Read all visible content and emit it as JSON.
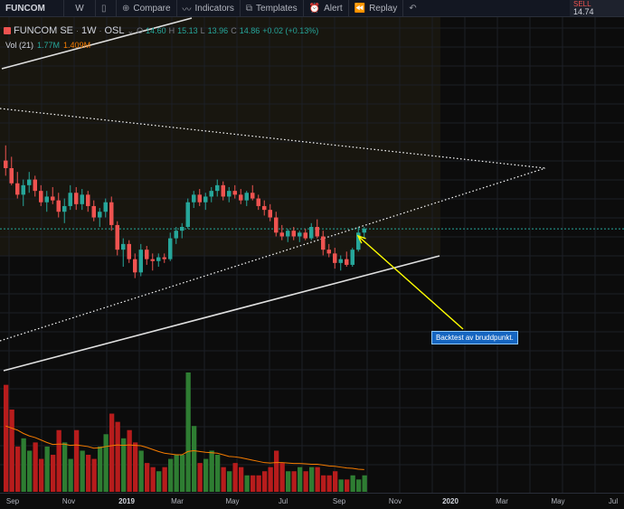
{
  "toolbar": {
    "symbol": "FUNCOM",
    "interval": "W",
    "compare": "Compare",
    "indicators": "Indicators",
    "templates": "Templates",
    "alert": "Alert",
    "replay": "Replay"
  },
  "quote": {
    "sell_label": "SELL",
    "sell_value": "14.74"
  },
  "legend": {
    "name": "FUNCOM SE",
    "interval": "1W",
    "exchange": "OSL",
    "open_label": "O",
    "open": "14.60",
    "high_label": "H",
    "high": "15.13",
    "low_label": "L",
    "low": "13.96",
    "close_label": "C",
    "close": "14.86",
    "change": "+0.02 (+0.13%)"
  },
  "volume_legend": {
    "label": "Vol (21)",
    "value1": "1.77M",
    "value2": "1.409M"
  },
  "annotation": {
    "text": "Backtest av bruddpunkt."
  },
  "xaxis": {
    "labels": [
      {
        "text": "Sep",
        "bold": false
      },
      {
        "text": "Nov",
        "bold": false
      },
      {
        "text": "2019",
        "bold": true
      },
      {
        "text": "Mar",
        "bold": false
      },
      {
        "text": "May",
        "bold": false
      },
      {
        "text": "Jul",
        "bold": false
      },
      {
        "text": "Sep",
        "bold": false
      },
      {
        "text": "Nov",
        "bold": false
      },
      {
        "text": "2020",
        "bold": true
      },
      {
        "text": "Mar",
        "bold": false
      },
      {
        "text": "May",
        "bold": false
      },
      {
        "text": "Jul",
        "bold": false
      }
    ]
  },
  "colors": {
    "up": "#26a69a",
    "down": "#ef5350",
    "vol_up": "#2e7d32",
    "vol_down": "#b71c1c",
    "ma": "#f57c00",
    "trendline": "#e0e0e0",
    "price_line": "#26a69a",
    "arrow": "#ffff00"
  },
  "chart_data": {
    "type": "candlestick",
    "candles": [
      [
        16.2,
        17.0,
        15.4,
        15.8
      ],
      [
        15.8,
        16.4,
        14.9,
        15.0
      ],
      [
        15.0,
        15.6,
        14.2,
        14.4
      ],
      [
        14.4,
        15.2,
        13.8,
        14.9
      ],
      [
        14.9,
        15.6,
        14.5,
        15.2
      ],
      [
        15.2,
        15.4,
        14.3,
        14.6
      ],
      [
        14.6,
        14.9,
        13.8,
        14.0
      ],
      [
        14.0,
        14.6,
        13.5,
        14.3
      ],
      [
        14.3,
        14.8,
        13.9,
        14.1
      ],
      [
        14.1,
        14.5,
        13.2,
        13.5
      ],
      [
        13.5,
        14.2,
        12.9,
        13.8
      ],
      [
        13.8,
        14.9,
        13.6,
        14.5
      ],
      [
        14.5,
        14.8,
        13.6,
        13.9
      ],
      [
        13.9,
        14.7,
        13.6,
        14.4
      ],
      [
        14.4,
        14.6,
        13.5,
        13.8
      ],
      [
        13.8,
        14.1,
        13.0,
        13.2
      ],
      [
        13.2,
        13.7,
        12.7,
        13.5
      ],
      [
        13.5,
        14.2,
        13.2,
        14.0
      ],
      [
        14.0,
        14.3,
        12.5,
        12.8
      ],
      [
        12.8,
        13.0,
        11.2,
        11.5
      ],
      [
        11.5,
        12.1,
        10.6,
        11.8
      ],
      [
        11.8,
        12.0,
        10.8,
        11.0
      ],
      [
        11.0,
        11.3,
        10.0,
        10.3
      ],
      [
        10.3,
        11.8,
        10.1,
        11.5
      ],
      [
        11.5,
        11.7,
        10.7,
        11.0
      ],
      [
        11.0,
        11.3,
        10.4,
        10.9
      ],
      [
        10.9,
        11.3,
        10.6,
        11.1
      ],
      [
        11.1,
        11.3,
        10.8,
        11.0
      ],
      [
        11.0,
        12.4,
        10.9,
        12.1
      ],
      [
        12.1,
        12.7,
        11.8,
        12.5
      ],
      [
        12.5,
        12.9,
        12.1,
        12.7
      ],
      [
        12.7,
        14.2,
        12.6,
        14.0
      ],
      [
        14.0,
        14.6,
        13.7,
        14.4
      ],
      [
        14.4,
        14.7,
        13.8,
        14.0
      ],
      [
        14.0,
        14.5,
        13.6,
        14.3
      ],
      [
        14.3,
        14.8,
        14.0,
        14.6
      ],
      [
        14.6,
        15.2,
        14.3,
        14.9
      ],
      [
        14.9,
        15.1,
        14.1,
        14.3
      ],
      [
        14.3,
        14.8,
        14.0,
        14.6
      ],
      [
        14.6,
        14.9,
        14.2,
        14.4
      ],
      [
        14.4,
        14.7,
        13.9,
        14.1
      ],
      [
        14.1,
        14.6,
        13.8,
        14.5
      ],
      [
        14.5,
        14.9,
        14.1,
        14.2
      ],
      [
        14.2,
        14.4,
        13.6,
        13.8
      ],
      [
        13.8,
        14.1,
        13.3,
        13.6
      ],
      [
        13.6,
        13.9,
        13.0,
        13.2
      ],
      [
        13.2,
        13.5,
        12.2,
        12.4
      ],
      [
        12.4,
        12.8,
        12.0,
        12.2
      ],
      [
        12.2,
        12.6,
        11.9,
        12.5
      ],
      [
        12.5,
        12.7,
        12.0,
        12.2
      ],
      [
        12.2,
        12.5,
        11.9,
        12.4
      ],
      [
        12.4,
        12.6,
        12.0,
        12.1
      ],
      [
        12.1,
        12.9,
        12.0,
        12.7
      ],
      [
        12.7,
        13.1,
        12.1,
        12.2
      ],
      [
        12.2,
        12.5,
        11.2,
        11.5
      ],
      [
        11.5,
        11.8,
        11.1,
        11.3
      ],
      [
        11.3,
        11.6,
        10.5,
        10.8
      ],
      [
        10.8,
        11.2,
        10.4,
        11.0
      ],
      [
        11.0,
        11.4,
        10.6,
        10.7
      ],
      [
        10.7,
        11.6,
        10.6,
        11.5
      ],
      [
        11.5,
        12.7,
        11.4,
        12.4
      ],
      [
        12.4,
        12.7,
        12.1,
        12.6
      ]
    ],
    "volume": [
      2.6,
      2.0,
      1.1,
      1.3,
      1.0,
      1.2,
      0.8,
      1.1,
      0.9,
      1.5,
      1.2,
      0.8,
      1.5,
      1.0,
      0.9,
      0.8,
      1.1,
      1.4,
      1.9,
      1.7,
      1.3,
      1.5,
      1.2,
      1.0,
      0.7,
      0.6,
      0.5,
      0.6,
      0.8,
      0.9,
      0.9,
      2.9,
      1.6,
      0.7,
      0.8,
      1.0,
      0.9,
      0.6,
      0.5,
      0.7,
      0.6,
      0.4,
      0.4,
      0.4,
      0.5,
      0.6,
      1.0,
      0.7,
      0.5,
      0.5,
      0.6,
      0.5,
      0.6,
      0.6,
      0.4,
      0.4,
      0.5,
      0.3,
      0.3,
      0.4,
      0.3,
      0.4
    ],
    "volume_ma": [
      1.6,
      1.55,
      1.5,
      1.42,
      1.36,
      1.32,
      1.26,
      1.2,
      1.15,
      1.16,
      1.16,
      1.13,
      1.14,
      1.12,
      1.1,
      1.06,
      1.07,
      1.1,
      1.12,
      1.14,
      1.13,
      1.14,
      1.13,
      1.12,
      1.08,
      1.03,
      0.98,
      0.94,
      0.92,
      0.9,
      0.9,
      0.98,
      1.0,
      0.98,
      0.96,
      0.95,
      0.94,
      0.9,
      0.86,
      0.85,
      0.83,
      0.8,
      0.77,
      0.74,
      0.71,
      0.7,
      0.71,
      0.71,
      0.7,
      0.69,
      0.69,
      0.68,
      0.67,
      0.67,
      0.65,
      0.63,
      0.62,
      0.6,
      0.58,
      0.57,
      0.55,
      0.54
    ],
    "price_line": 12.6,
    "ylim": [
      5.5,
      19.9
    ]
  }
}
